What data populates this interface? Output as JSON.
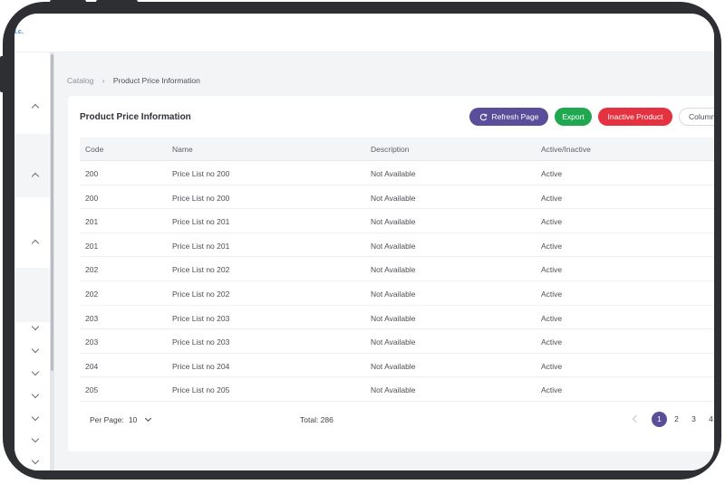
{
  "app": {
    "brand_fragment": "i.c."
  },
  "breadcrumb": {
    "root": "Catalog",
    "separator": "›",
    "current": "Product Price Information"
  },
  "card": {
    "title": "Product Price Information",
    "buttons": {
      "refresh": "Refresh Page",
      "export": "Export",
      "inactive": "Inactive Product",
      "columns": "Columns"
    }
  },
  "table": {
    "columns": [
      "Code",
      "Name",
      "Description",
      "Active/Inactive"
    ],
    "rows": [
      {
        "code": "200",
        "name": "Price List no 200",
        "description": "Not Available",
        "status": "Active"
      },
      {
        "code": "200",
        "name": "Price List no 200",
        "description": "Not Available",
        "status": "Active"
      },
      {
        "code": "201",
        "name": "Price List no 201",
        "description": "Not Available",
        "status": "Active"
      },
      {
        "code": "201",
        "name": "Price List no 201",
        "description": "Not Available",
        "status": "Active"
      },
      {
        "code": "202",
        "name": "Price List no 202",
        "description": "Not Available",
        "status": "Active"
      },
      {
        "code": "202",
        "name": "Price List no 202",
        "description": "Not Available",
        "status": "Active"
      },
      {
        "code": "203",
        "name": "Price List no 203",
        "description": "Not Available",
        "status": "Active"
      },
      {
        "code": "203",
        "name": "Price List no 203",
        "description": "Not Available",
        "status": "Active"
      },
      {
        "code": "204",
        "name": "Price List no 204",
        "description": "Not Available",
        "status": "Active"
      },
      {
        "code": "205",
        "name": "Price List no 205",
        "description": "Not Available",
        "status": "Active"
      }
    ]
  },
  "footer": {
    "per_page_label": "Per Page:",
    "per_page_value": "10",
    "total_label": "Total: 286",
    "pages": [
      "1",
      "2",
      "3",
      "4"
    ],
    "current_page": "1"
  },
  "sidebar": {
    "chevrons": [
      "chevron-up-icon",
      "chevron-up-icon",
      "chevron-up-icon",
      "chevron-down-icon",
      "chevron-down-icon",
      "chevron-down-icon",
      "chevron-down-icon",
      "chevron-down-icon",
      "chevron-down-icon",
      "chevron-down-icon"
    ]
  },
  "colors": {
    "primary": "#5a4e9a",
    "export": "#1fa84f",
    "inactive": "#e43241",
    "device_frame": "#2e2f33"
  }
}
